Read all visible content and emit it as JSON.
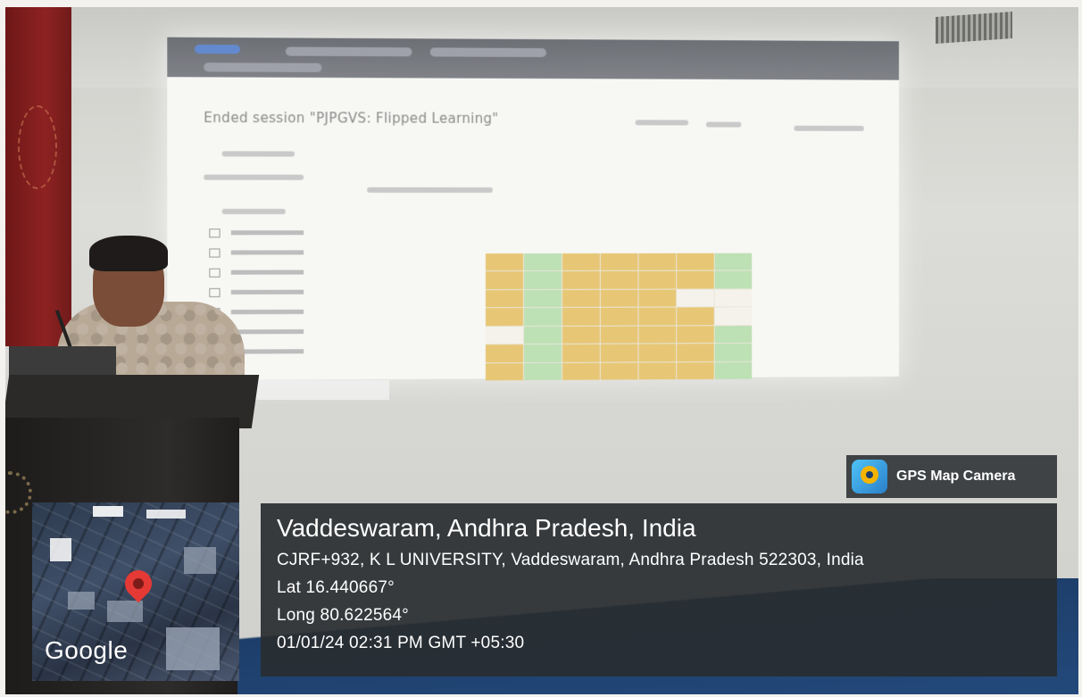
{
  "screen": {
    "heading": "Ended session \"PJPGVS: Flipped Learning\""
  },
  "map": {
    "logo": "Google",
    "pin_icon": "map-pin-icon"
  },
  "gps_badge": {
    "label": "GPS Map Camera",
    "icon": "gps-map-camera-icon"
  },
  "location": {
    "place": "Vaddeswaram, Andhra Pradesh, India",
    "address": "CJRF+932, K L UNIVERSITY, Vaddeswaram, Andhra Pradesh 522303, India",
    "latitude": "Lat 16.440667°",
    "longitude": "Long 80.622564°",
    "datetime": "01/01/24 02:31 PM GMT +05:30"
  }
}
